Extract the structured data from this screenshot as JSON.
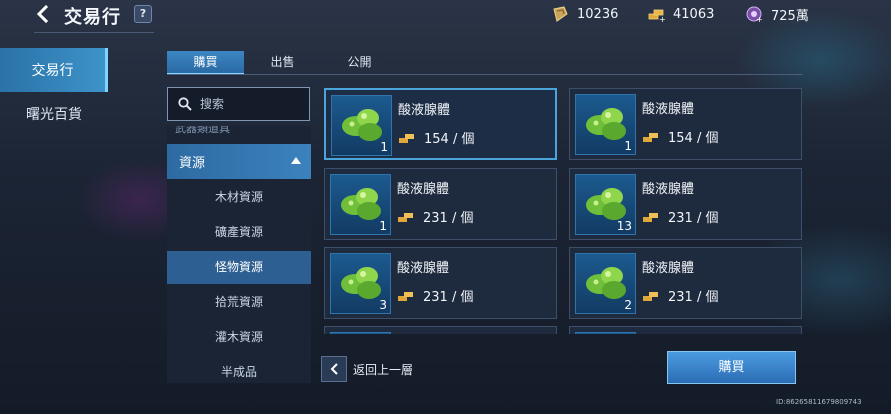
{
  "header": {
    "title": "交易行",
    "help_label": "?",
    "currencies": [
      {
        "icon": "crystal-icon",
        "amount": "10236",
        "color": "#c9a45a"
      },
      {
        "icon": "gold-bars-icon",
        "amount": "41063",
        "color": "#e0a83a"
      },
      {
        "icon": "purple-gem-icon",
        "amount": "725萬",
        "color": "#b68ad8"
      }
    ]
  },
  "nav": {
    "items": [
      {
        "label": "交易行",
        "active": true
      },
      {
        "label": "曙光百貨",
        "active": false
      }
    ]
  },
  "tabs": [
    {
      "label": "購買",
      "active": true
    },
    {
      "label": "出售",
      "active": false
    },
    {
      "label": "公開",
      "active": false
    }
  ],
  "search": {
    "placeholder": "搜索"
  },
  "categories": {
    "cut_off_label": "武器類道具",
    "header": "資源",
    "subitems": [
      {
        "label": "木材資源",
        "active": false
      },
      {
        "label": "礦產資源",
        "active": false
      },
      {
        "label": "怪物資源",
        "active": true
      },
      {
        "label": "拾荒資源",
        "active": false
      },
      {
        "label": "灌木資源",
        "active": false
      },
      {
        "label": "半成品",
        "active": false
      }
    ]
  },
  "listings": [
    {
      "name": "酸液腺體",
      "price": "154 / 個",
      "qty": "1",
      "selected": true
    },
    {
      "name": "酸液腺體",
      "price": "154 / 個",
      "qty": "1",
      "selected": false
    },
    {
      "name": "酸液腺體",
      "price": "231 / 個",
      "qty": "1",
      "selected": false
    },
    {
      "name": "酸液腺體",
      "price": "231 / 個",
      "qty": "13",
      "selected": false
    },
    {
      "name": "酸液腺體",
      "price": "231 / 個",
      "qty": "3",
      "selected": false
    },
    {
      "name": "酸液腺體",
      "price": "231 / 個",
      "qty": "2",
      "selected": false
    },
    {
      "name": "",
      "price": "",
      "qty": "",
      "selected": false
    },
    {
      "name": "",
      "price": "",
      "qty": "",
      "selected": false
    }
  ],
  "footer": {
    "back_label": "返回上一層",
    "buy_label": "購買",
    "device_id": "ID:86265811679809743"
  },
  "colors": {
    "accent": "#3b86c4",
    "selected_border": "#4aa6da"
  }
}
